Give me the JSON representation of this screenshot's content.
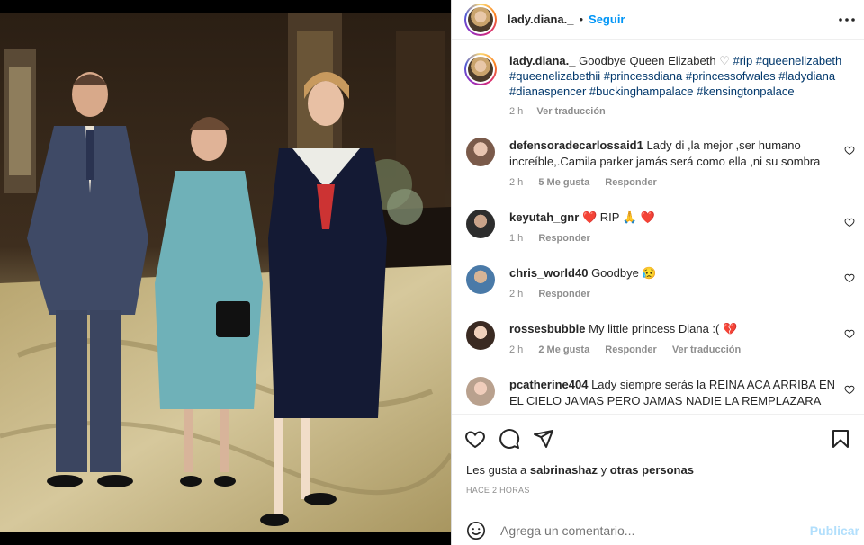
{
  "post": {
    "username": "lady.diana._",
    "dot": "•",
    "follow_label": "Seguir"
  },
  "caption": {
    "username": "lady.diana._",
    "text": "Goodbye Queen Elizabeth",
    "heart": "♡",
    "tags": "#rip #queenelizabeth #queenelizabethii #princessdiana #princessofwales #ladydiana #dianaspencer #buckinghampalace #kensingtonpalace",
    "time": "2 h",
    "translate": "Ver traducción"
  },
  "comments": [
    {
      "username": "defensoradecarlossaid1",
      "text": "Lady di ,la mejor ,ser humano increíble,.Camila parker jamás será como ella ,ni su sombra",
      "time": "2 h",
      "likes": "5 Me gusta",
      "reply": "Responder",
      "translate": ""
    },
    {
      "username": "keyutah_gnr",
      "text": "❤️ RIP 🙏 ❤️",
      "time": "1 h",
      "likes": "",
      "reply": "Responder",
      "translate": ""
    },
    {
      "username": "chris_world40",
      "text": "Goodbye 😥",
      "time": "2 h",
      "likes": "",
      "reply": "Responder",
      "translate": ""
    },
    {
      "username": "rossesbubble",
      "text": "My little princess Diana :( 💔",
      "time": "2 h",
      "likes": "2 Me gusta",
      "reply": "Responder",
      "translate": "Ver traducción"
    },
    {
      "username": "pcatherine404",
      "text": "Lady siempre serás la REINA ACA ARRIBA EN EL CIELO JAMAS PERO JAMAS NADIE LA REMPLAZARA",
      "time": "",
      "likes": "",
      "reply": "",
      "translate": ""
    }
  ],
  "likes_line": {
    "prefix": "Les gusta a",
    "user": "sabrinashaz",
    "joiner": "y",
    "others": "otras personas"
  },
  "timestamp": "HACE 2 HORAS",
  "add_comment": {
    "placeholder": "Agrega un comentario...",
    "publish_label": "Publicar"
  },
  "icons": {
    "like": "heart-icon",
    "comment": "comment-bubble-icon",
    "share": "paper-plane-icon",
    "save": "bookmark-icon",
    "more": "more-options-icon",
    "emoji": "smiley-icon"
  },
  "colors": {
    "link_blue": "#0095f6",
    "hashtag": "#00376b",
    "muted": "#8e8e8e",
    "publish_disabled": "#b2dffc"
  }
}
